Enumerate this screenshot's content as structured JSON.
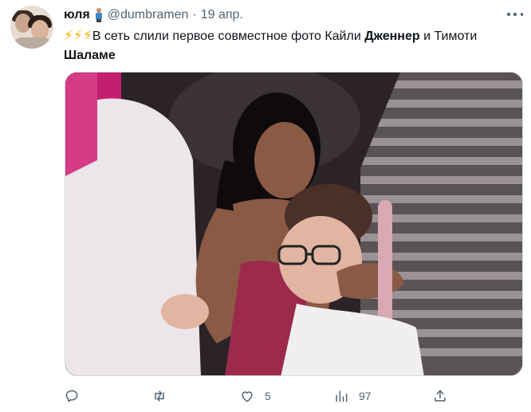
{
  "author": {
    "name": "юля",
    "handle": "@dumbramen",
    "separator": "·",
    "date": "19 апр."
  },
  "tweet_text": {
    "part1": "В сеть слили первое совместное фото Кайли ",
    "bold1": "Дженнер",
    "part2": " и Тимоти ",
    "bold2": "Шаламе"
  },
  "icons": {
    "reply": "reply-icon",
    "retweet": "retweet-icon",
    "like": "heart-icon",
    "views": "views-icon",
    "share": "share-icon",
    "more": "more-icon",
    "bolt": "high-voltage-icon"
  },
  "stats": {
    "likes": "5",
    "views": "97"
  },
  "colors": {
    "text": "#0f1419",
    "secondary": "#536471",
    "bolt": "#f4b400"
  }
}
